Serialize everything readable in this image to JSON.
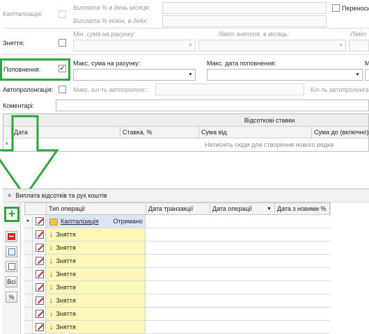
{
  "form": {
    "capitalization_label": "Капіталізація:",
    "payment_day_label": "Виплата % в день місяця:",
    "payment_every_label": "Виплата % кожні, в днях:",
    "transfer_label": "Переноси",
    "withdrawal_label": "Зняття:",
    "min_sum_label": "Мін. сума на рахунку:",
    "withdraw_limit_label": "Ліміт зняття, в місяць:",
    "limit_label": "Ліміт",
    "replenish_label": "Поповнення:",
    "max_sum_label": "Макс. сума на рахунку:",
    "max_date_label": "Макс. дата поповнення:",
    "edge_label": "М",
    "autoprolong_label": "Автопролонгація:",
    "max_autoprolong_label": "Макс. кіл-ть автопролонг.:",
    "autoprolong_limit_label": "Кіл-ть автопролонга",
    "comments_label": "Коментарі:"
  },
  "rates_grid": {
    "band_title": "Відсоткові ставки",
    "columns": [
      "Дата",
      "Ставка, %",
      "Сума від",
      "Сума до (включно)"
    ],
    "new_row_marker": "*",
    "new_row_hint": "Натисніть сюди для створення нового рядка"
  },
  "movements_panel": {
    "collapse_glyph": "˄",
    "title": "Виплата відсотків та рух коштів",
    "toolbar": {
      "add_icon": "+",
      "remove_icon": "−",
      "all_label": "Всі",
      "percent_label": "%"
    },
    "columns": [
      "Тип операції",
      "Дата транзакції",
      "Дата операції",
      "Дата з новими %"
    ],
    "sort_glyph": "▼",
    "rows": [
      {
        "marker": "▸",
        "type": "Капіталізація",
        "status": "Отримано"
      },
      {
        "marker": "",
        "type": "Зняття",
        "status": ""
      },
      {
        "marker": "",
        "type": "Зняття",
        "status": ""
      },
      {
        "marker": "",
        "type": "Зняття",
        "status": ""
      },
      {
        "marker": "",
        "type": "Зняття",
        "status": ""
      },
      {
        "marker": "",
        "type": "Зняття",
        "status": ""
      },
      {
        "marker": "",
        "type": "Зняття",
        "status": ""
      },
      {
        "marker": "",
        "type": "Зняття",
        "status": ""
      },
      {
        "marker": "",
        "type": "Зняття",
        "status": ""
      }
    ]
  },
  "colors": {
    "highlight": "#2fa33d",
    "op_type_cell": "#fbf7b9",
    "remove_button": "#d22828",
    "withdraw_arrow": "#d43a1a"
  }
}
